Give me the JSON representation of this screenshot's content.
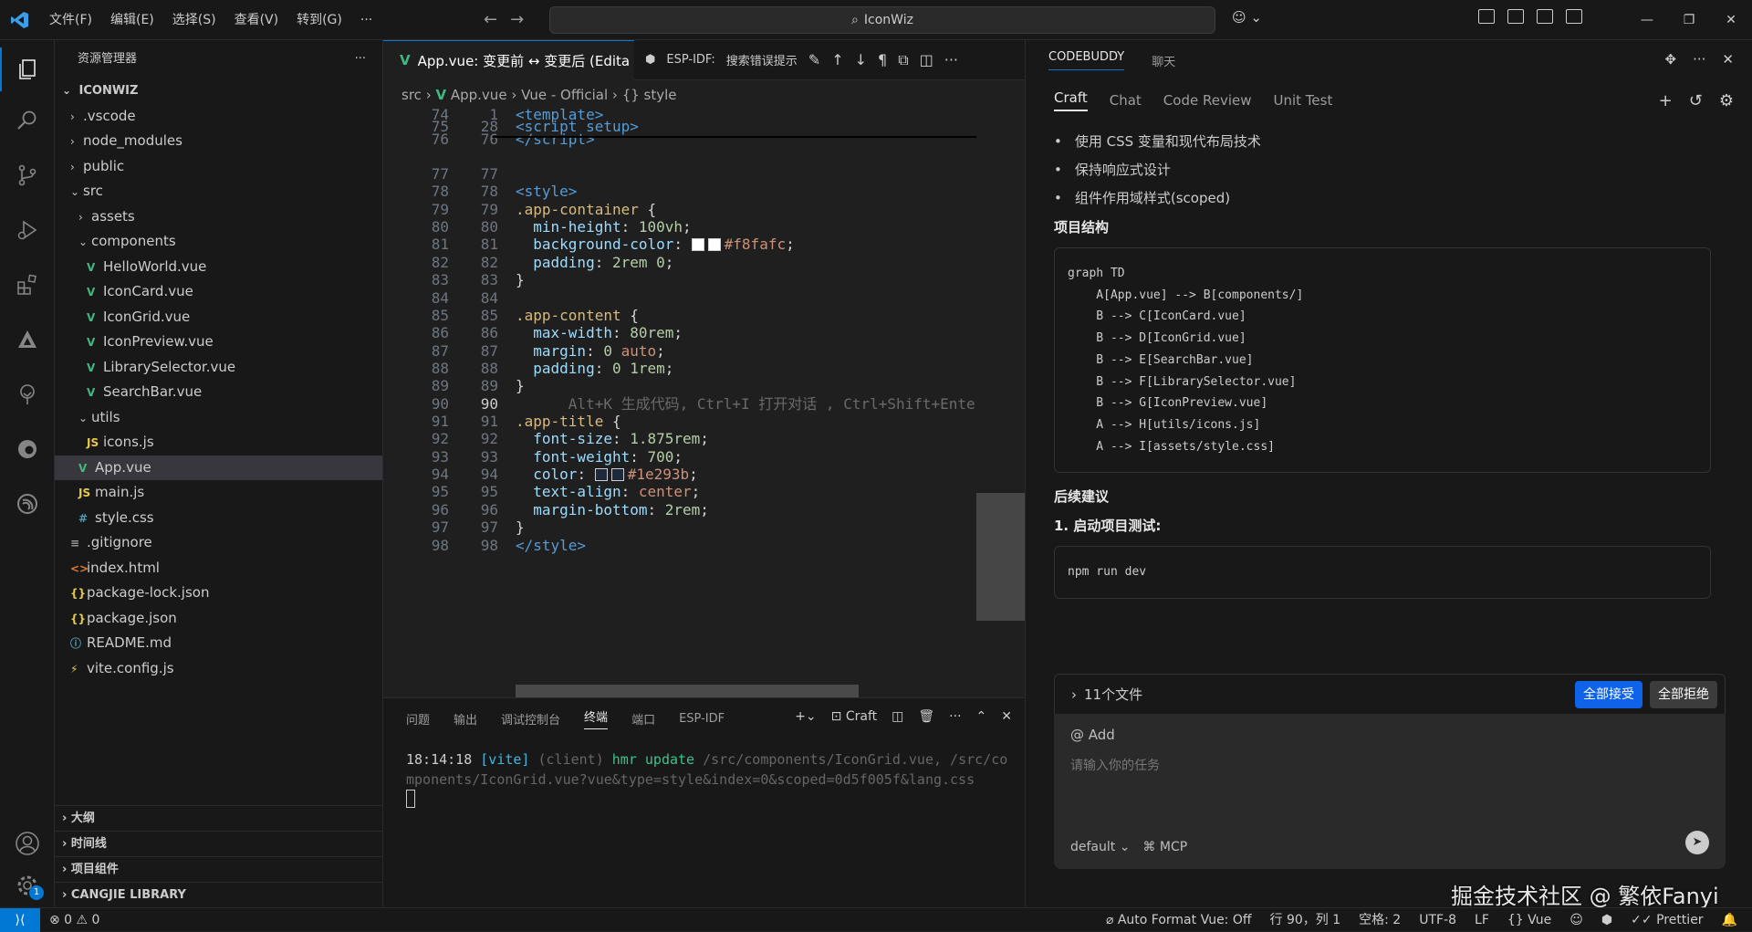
{
  "titlebar": {
    "menu": [
      "文件(F)",
      "编辑(E)",
      "选择(S)",
      "查看(V)",
      "转到(G)",
      "···"
    ],
    "search_text": "IconWiz"
  },
  "sidebar": {
    "title": "资源管理器",
    "root": "ICONWIZ",
    "tree": [
      {
        "label": ".vscode",
        "indent": 1,
        "kind": "folder",
        "open": false
      },
      {
        "label": "node_modules",
        "indent": 1,
        "kind": "folder",
        "open": false
      },
      {
        "label": "public",
        "indent": 1,
        "kind": "folder",
        "open": false
      },
      {
        "label": "src",
        "indent": 1,
        "kind": "folder",
        "open": true
      },
      {
        "label": "assets",
        "indent": 2,
        "kind": "folder",
        "open": false
      },
      {
        "label": "components",
        "indent": 2,
        "kind": "folder",
        "open": true
      },
      {
        "label": "HelloWorld.vue",
        "indent": 3,
        "kind": "vue"
      },
      {
        "label": "IconCard.vue",
        "indent": 3,
        "kind": "vue"
      },
      {
        "label": "IconGrid.vue",
        "indent": 3,
        "kind": "vue"
      },
      {
        "label": "IconPreview.vue",
        "indent": 3,
        "kind": "vue"
      },
      {
        "label": "LibrarySelector.vue",
        "indent": 3,
        "kind": "vue"
      },
      {
        "label": "SearchBar.vue",
        "indent": 3,
        "kind": "vue"
      },
      {
        "label": "utils",
        "indent": 2,
        "kind": "folder",
        "open": true
      },
      {
        "label": "icons.js",
        "indent": 3,
        "kind": "js"
      },
      {
        "label": "App.vue",
        "indent": 2,
        "kind": "vue",
        "selected": true
      },
      {
        "label": "main.js",
        "indent": 2,
        "kind": "js"
      },
      {
        "label": "style.css",
        "indent": 2,
        "kind": "css"
      },
      {
        "label": ".gitignore",
        "indent": 1,
        "kind": "git"
      },
      {
        "label": "index.html",
        "indent": 1,
        "kind": "html"
      },
      {
        "label": "package-lock.json",
        "indent": 1,
        "kind": "json"
      },
      {
        "label": "package.json",
        "indent": 1,
        "kind": "json"
      },
      {
        "label": "README.md",
        "indent": 1,
        "kind": "info"
      },
      {
        "label": "vite.config.js",
        "indent": 1,
        "kind": "vite"
      }
    ],
    "panels": [
      "大纲",
      "时间线",
      "项目组件",
      "CANGJIE LIBRARY"
    ]
  },
  "editor": {
    "tab_title": "App.vue: 变更前 ↔ 变更后 (Edita",
    "tool_espidf": "ESP-IDF:",
    "tool_search": "搜索错误提示",
    "breadcrumb": {
      "p1": "src",
      "p2": "App.vue",
      "p3": "Vue - Official",
      "p4": "{} style"
    },
    "lines": [
      {
        "a": "74",
        "b": "1",
        "html": "<span class='tag'>&lt;template&gt;</span>"
      },
      {
        "a": "75",
        "b": "28",
        "html": "<span class='tag'>&lt;script setup&gt;</span>"
      },
      {
        "a": "76",
        "b": "76",
        "html": "<span class='tag'>&lt;/script&gt;</span>"
      },
      {
        "a": "77",
        "b": "77",
        "html": ""
      },
      {
        "a": "78",
        "b": "78",
        "html": "<span class='tag'>&lt;style&gt;</span>"
      },
      {
        "a": "79",
        "b": "79",
        "html": "<span class='sel'>.app-container</span> <span class='pun'>{</span>"
      },
      {
        "a": "80",
        "b": "80",
        "html": "  <span class='prop'>min-height</span>: <span class='num'>100vh</span>;"
      },
      {
        "a": "81",
        "b": "81",
        "html": "  <span class='prop'>background-color</span>: <span class='swatch' style='background:#fff'></span><span class='swatch' style='background:#fff'></span><span class='val'>#f8fafc</span>;"
      },
      {
        "a": "82",
        "b": "82",
        "html": "  <span class='prop'>padding</span>: <span class='num'>2rem 0</span>;"
      },
      {
        "a": "83",
        "b": "83",
        "html": "<span class='pun'>}</span>"
      },
      {
        "a": "84",
        "b": "84",
        "html": ""
      },
      {
        "a": "85",
        "b": "85",
        "html": "<span class='sel'>.app-content</span> <span class='pun'>{</span>"
      },
      {
        "a": "86",
        "b": "86",
        "html": "  <span class='prop'>max-width</span>: <span class='num'>80rem</span>;"
      },
      {
        "a": "87",
        "b": "87",
        "html": "  <span class='prop'>margin</span>: <span class='num'>0</span> <span class='val'>auto</span>;"
      },
      {
        "a": "88",
        "b": "88",
        "html": "  <span class='prop'>padding</span>: <span class='num'>0 1rem</span>;"
      },
      {
        "a": "89",
        "b": "89",
        "html": "<span class='pun'>}</span>"
      },
      {
        "a": "90",
        "b": "90",
        "cur": true,
        "html": "      <span class='hint'>Alt+K 生成代码, Ctrl+I 打开对话 , Ctrl+Shift+Ente</span>"
      },
      {
        "a": "91",
        "b": "91",
        "html": "<span class='sel'>.app-title</span> <span class='pun'>{</span>"
      },
      {
        "a": "92",
        "b": "92",
        "html": "  <span class='prop'>font-size</span>: <span class='num'>1.875rem</span>;"
      },
      {
        "a": "93",
        "b": "93",
        "html": "  <span class='prop'>font-weight</span>: <span class='num'>700</span>;"
      },
      {
        "a": "94",
        "b": "94",
        "html": "  <span class='prop'>color</span>: <span class='swatch' style='background:#1e293b'></span><span class='swatch' style='background:#1e293b'></span><span class='val'>#1e293b</span>;"
      },
      {
        "a": "95",
        "b": "95",
        "html": "  <span class='prop'>text-align</span>: <span class='val'>center</span>;"
      },
      {
        "a": "96",
        "b": "96",
        "html": "  <span class='prop'>margin-bottom</span>: <span class='num'>2rem</span>;"
      },
      {
        "a": "97",
        "b": "97",
        "html": "<span class='pun'>}</span>"
      },
      {
        "a": "98",
        "b": "98",
        "html": "<span class='tag'>&lt;/style&gt;</span>"
      }
    ]
  },
  "panel": {
    "tabs": [
      "问题",
      "输出",
      "调试控制台",
      "终端",
      "端口",
      "ESP-IDF"
    ],
    "active_tab": "终端",
    "craft_label": "Craft",
    "term_time": "18:14:18",
    "term_vite": "[vite]",
    "term_client": "(client)",
    "term_hmr": "hmr update",
    "term_path1": "/src/components/IconGrid.vue, /src/co",
    "term_path2": "mponents/IconGrid.vue?vue&type=style&index=0&scoped=0d5f005f&lang.css"
  },
  "chat": {
    "tabs": [
      "CODEBUDDY",
      "聊天"
    ],
    "subtabs": [
      "Craft",
      "Chat",
      "Code Review",
      "Unit Test"
    ],
    "bullets": [
      "使用 CSS 变量和现代布局技术",
      "保持响应式设计",
      "组件作用域样式(scoped)"
    ],
    "structure_title": "项目结构",
    "graph_code": "graph TD\n    A[App.vue] --> B[components/]\n    B --> C[IconCard.vue]\n    B --> D[IconGrid.vue]\n    B --> E[SearchBar.vue]\n    B --> F[LibrarySelector.vue]\n    B --> G[IconPreview.vue]\n    A --> H[utils/icons.js]\n    A --> I[assets/style.css]",
    "followup_title": "后续建议",
    "step1": "1. 启动项目测试:",
    "npm_code": "npm run dev",
    "files_label": "11个文件",
    "accept_all": "全部接受",
    "reject_all": "全部拒绝",
    "add_label": "@ Add",
    "placeholder": "请输入你的任务",
    "mode": "default",
    "mcp": "MCP"
  },
  "watermark": "掘金技术社区 @ 繁依Fanyi",
  "statusbar": {
    "problems": "⊗ 0 ⚠ 0",
    "autoformat": "Auto Format Vue: Off",
    "position": "行 90，列 1",
    "spaces": "空格: 2",
    "encoding": "UTF-8",
    "eol": "LF",
    "language": "Vue",
    "prettier": "Prettier"
  },
  "colors": {
    "accent": "#0078d4",
    "vue": "#41b883",
    "js": "#e8c94a",
    "accept": "#0e63e8"
  }
}
